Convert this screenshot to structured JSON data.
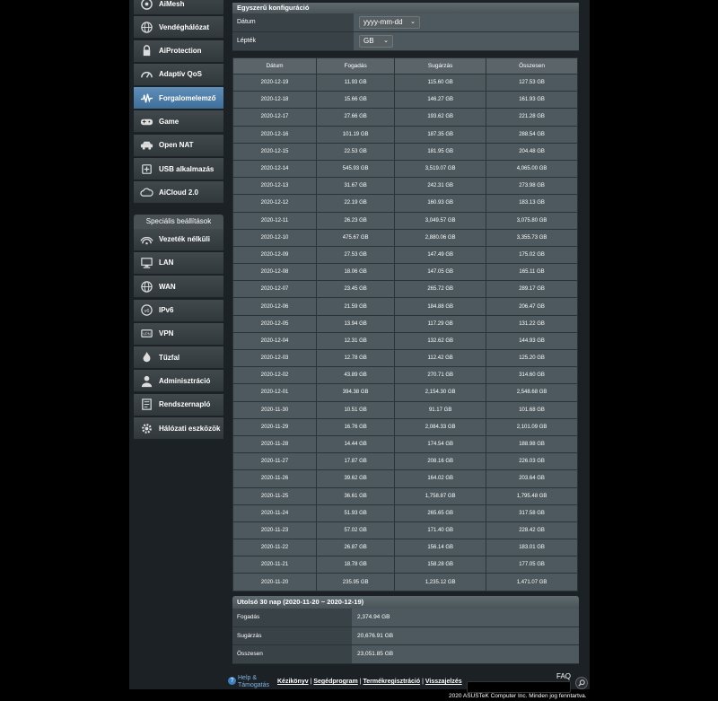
{
  "sidebar": {
    "items": [
      {
        "label": "AiMesh",
        "icon": "aimesh-icon"
      },
      {
        "label": "Vendéghálózat",
        "icon": "globe-icon"
      },
      {
        "label": "AiProtection",
        "icon": "lock-icon"
      },
      {
        "label": "Adaptív QoS",
        "icon": "gauge-icon"
      },
      {
        "label": "Forgalomelemző",
        "icon": "traffic-wave-icon",
        "active": true
      },
      {
        "label": "Game",
        "icon": "gamepad-icon"
      },
      {
        "label": "Open NAT",
        "icon": "car-icon"
      },
      {
        "label": "USB alkalmazás",
        "icon": "usb-icon"
      },
      {
        "label": "AiCloud 2.0",
        "icon": "cloud-icon"
      }
    ],
    "section_title": "Speciális beállítások",
    "advanced": [
      {
        "label": "Vezeték nélküli",
        "icon": "wireless-icon"
      },
      {
        "label": "LAN",
        "icon": "lan-icon"
      },
      {
        "label": "WAN",
        "icon": "wan-globe-icon"
      },
      {
        "label": "IPv6",
        "icon": "ipv6-icon"
      },
      {
        "label": "VPN",
        "icon": "vpn-icon"
      },
      {
        "label": "Tűzfal",
        "icon": "firewall-icon"
      },
      {
        "label": "Adminisztráció",
        "icon": "admin-icon"
      },
      {
        "label": "Rendszernapló",
        "icon": "log-icon"
      },
      {
        "label": "Hálózati eszközök",
        "icon": "gear-icon"
      }
    ]
  },
  "config": {
    "title": "Egyszerű konfiguráció",
    "date_label": "Dátum",
    "date_value": "yyyy-mm-dd",
    "scale_label": "Lépték",
    "scale_value": "GB"
  },
  "table": {
    "headers": [
      "Dátum",
      "Fogadás",
      "Sugárzás",
      "Összesen"
    ],
    "rows": [
      [
        "2020-12-19",
        "11.93 GB",
        "115.60 GB",
        "127.53 GB"
      ],
      [
        "2020-12-18",
        "15.66 GB",
        "146.27 GB",
        "161.93 GB"
      ],
      [
        "2020-12-17",
        "27.66 GB",
        "193.62 GB",
        "221.28 GB"
      ],
      [
        "2020-12-16",
        "101.19 GB",
        "187.35 GB",
        "288.54 GB"
      ],
      [
        "2020-12-15",
        "22.53 GB",
        "181.95 GB",
        "204.48 GB"
      ],
      [
        "2020-12-14",
        "545.93 GB",
        "3,519.07 GB",
        "4,065.00 GB"
      ],
      [
        "2020-12-13",
        "31.67 GB",
        "242.31 GB",
        "273.98 GB"
      ],
      [
        "2020-12-12",
        "22.19 GB",
        "160.93 GB",
        "183.13 GB"
      ],
      [
        "2020-12-11",
        "26.23 GB",
        "3,049.57 GB",
        "3,075.80 GB"
      ],
      [
        "2020-12-10",
        "475.67 GB",
        "2,880.06 GB",
        "3,355.73 GB"
      ],
      [
        "2020-12-09",
        "27.53 GB",
        "147.49 GB",
        "175.02 GB"
      ],
      [
        "2020-12-08",
        "18.06 GB",
        "147.05 GB",
        "165.11 GB"
      ],
      [
        "2020-12-07",
        "23.45 GB",
        "265.72 GB",
        "289.17 GB"
      ],
      [
        "2020-12-06",
        "21.59 GB",
        "184.88 GB",
        "206.47 GB"
      ],
      [
        "2020-12-05",
        "13.94 GB",
        "117.29 GB",
        "131.22 GB"
      ],
      [
        "2020-12-04",
        "12.31 GB",
        "132.62 GB",
        "144.93 GB"
      ],
      [
        "2020-12-03",
        "12.78 GB",
        "112.42 GB",
        "125.20 GB"
      ],
      [
        "2020-12-02",
        "43.89 GB",
        "270.71 GB",
        "314.60 GB"
      ],
      [
        "2020-12-01",
        "394.38 GB",
        "2,154.30 GB",
        "2,548.68 GB"
      ],
      [
        "2020-11-30",
        "10.51 GB",
        "91.17 GB",
        "101.68 GB"
      ],
      [
        "2020-11-29",
        "16.76 GB",
        "2,084.33 GB",
        "2,101.09 GB"
      ],
      [
        "2020-11-28",
        "14.44 GB",
        "174.54 GB",
        "188.98 GB"
      ],
      [
        "2020-11-27",
        "17.87 GB",
        "208.16 GB",
        "226.03 GB"
      ],
      [
        "2020-11-26",
        "39.62 GB",
        "164.02 GB",
        "203.64 GB"
      ],
      [
        "2020-11-25",
        "36.61 GB",
        "1,758.87 GB",
        "1,795.48 GB"
      ],
      [
        "2020-11-24",
        "51.93 GB",
        "265.65 GB",
        "317.58 GB"
      ],
      [
        "2020-11-23",
        "57.02 GB",
        "171.40 GB",
        "228.42 GB"
      ],
      [
        "2020-11-22",
        "26.87 GB",
        "156.14 GB",
        "183.01 GB"
      ],
      [
        "2020-11-21",
        "18.78 GB",
        "158.28 GB",
        "177.05 GB"
      ],
      [
        "2020-11-20",
        "235.95 GB",
        "1,235.12 GB",
        "1,471.07 GB"
      ]
    ]
  },
  "summary": {
    "title": "Utolsó 30 nap (2020-11-20 ~ 2020-12-19)",
    "rows": [
      {
        "label": "Fogadás",
        "value": "2,374.94 GB"
      },
      {
        "label": "Sugárzás",
        "value": "20,676.91 GB"
      },
      {
        "label": "Összesen",
        "value": "23,051.85 GB"
      }
    ]
  },
  "footer": {
    "help_line1": "Help &",
    "help_line2": "Támogatás",
    "links": [
      "Kézikönyv",
      "Segédprogram",
      "Termékregisztráció",
      "Visszajelzés"
    ],
    "separator": " | ",
    "faq": "FAQ",
    "copyright": "2020 ASUSTeK Computer Inc. Minden jog fenntartva."
  },
  "colors": {
    "accent": "#4f82ad",
    "panel": "#4d595e",
    "background": "#000000"
  }
}
